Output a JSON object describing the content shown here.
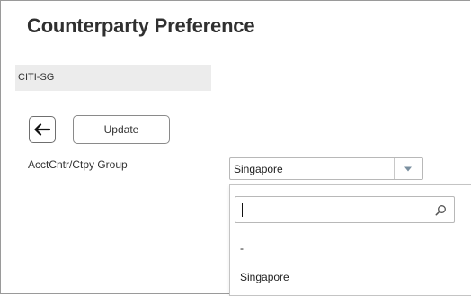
{
  "page": {
    "title": "Counterparty Preference"
  },
  "counterparty": {
    "value": "CITI-SG"
  },
  "actions": {
    "update_label": "Update"
  },
  "form": {
    "acct_group_label": "AcctCntr/Ctpy Group",
    "selected_value": "Singapore"
  },
  "dropdown": {
    "search_value": "",
    "options": [
      {
        "label": "-"
      },
      {
        "label": "Singapore"
      }
    ]
  },
  "icons": {
    "back": "arrow-left-icon",
    "dropdown": "caret-down-icon",
    "search": "search-icon"
  },
  "colors": {
    "title": "#303030",
    "field_background": "#ececec",
    "border": "#b8b8b8",
    "arrow": "#7a8f9f"
  }
}
